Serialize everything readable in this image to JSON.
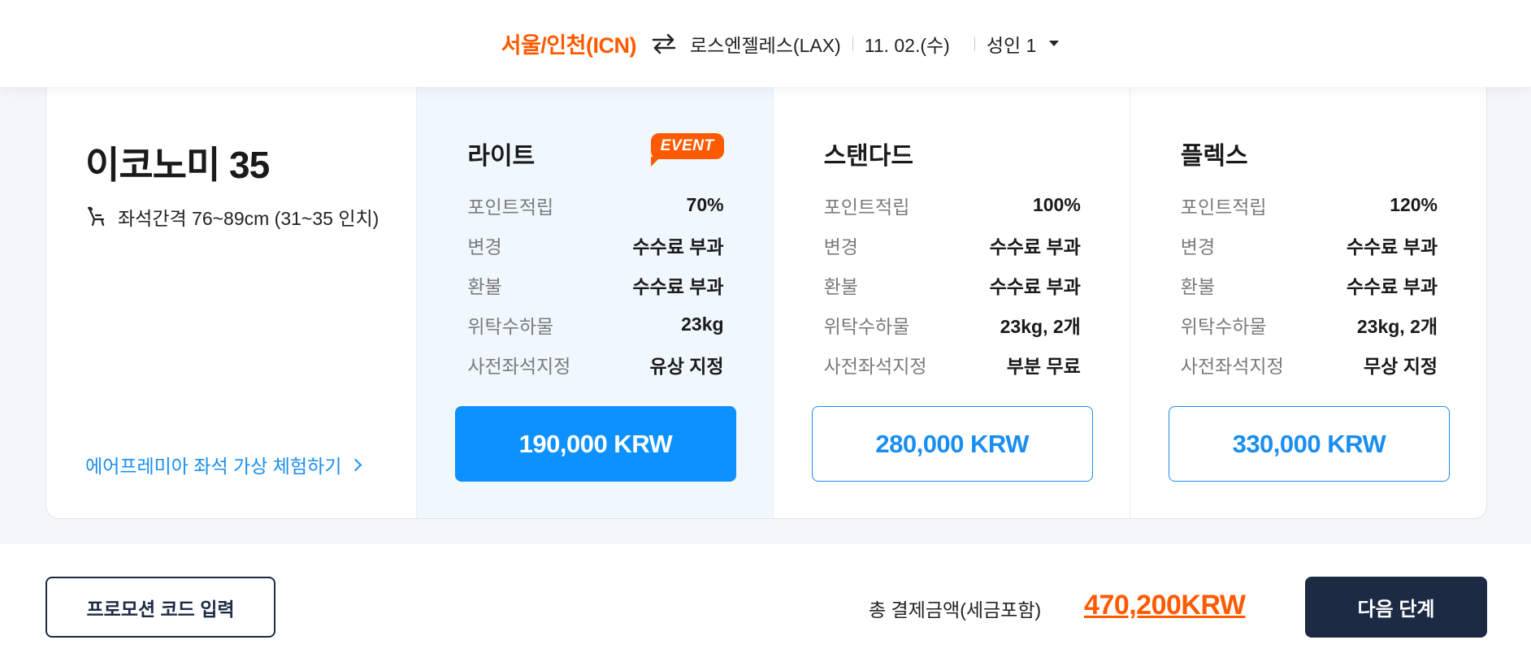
{
  "route": {
    "origin": "서울/인천(ICN)",
    "destination": "로스엔젤레스(LAX)",
    "date": "11. 02.(수)",
    "passengers": "성인 1",
    "swap_icon": "swap-arrows-icon",
    "dropdown_icon": "caret-down-icon"
  },
  "cabin": {
    "title": "이코노미 35",
    "seat_pitch": "좌석간격 76~89cm (31~35 인치)",
    "seat_icon": "seat-icon",
    "vr_link": "에어프레미아 좌석 가상 체험하기"
  },
  "fares": [
    {
      "name": "라이트",
      "badge": "EVENT",
      "rows": [
        {
          "label": "포인트적립",
          "value": "70%"
        },
        {
          "label": "변경",
          "value": "수수료 부과"
        },
        {
          "label": "환불",
          "value": "수수료 부과"
        },
        {
          "label": "위탁수하물",
          "value": "23kg"
        },
        {
          "label": "사전좌석지정",
          "value": "유상 지정"
        }
      ],
      "price": "190,000 KRW"
    },
    {
      "name": "스탠다드",
      "rows": [
        {
          "label": "포인트적립",
          "value": "100%"
        },
        {
          "label": "변경",
          "value": "수수료 부과"
        },
        {
          "label": "환불",
          "value": "수수료 부과"
        },
        {
          "label": "위탁수하물",
          "value": "23kg, 2개"
        },
        {
          "label": "사전좌석지정",
          "value": "부분 무료"
        }
      ],
      "price": "280,000 KRW"
    },
    {
      "name": "플렉스",
      "rows": [
        {
          "label": "포인트적립",
          "value": "120%"
        },
        {
          "label": "변경",
          "value": "수수료 부과"
        },
        {
          "label": "환불",
          "value": "수수료 부과"
        },
        {
          "label": "위탁수하물",
          "value": "23kg, 2개"
        },
        {
          "label": "사전좌석지정",
          "value": "무상 지정"
        }
      ],
      "price": "330,000 KRW"
    }
  ],
  "footer": {
    "promo_button": "프로모션 코드 입력",
    "total_label": "총 결제금액(세금포함)",
    "total_amount": "470,200KRW",
    "next_button": "다음 단계"
  },
  "colors": {
    "accent_orange": "#ff5a00",
    "primary_blue": "#0c91ff",
    "navy": "#1c2a44",
    "selected_bg": "#f0f7fd"
  }
}
